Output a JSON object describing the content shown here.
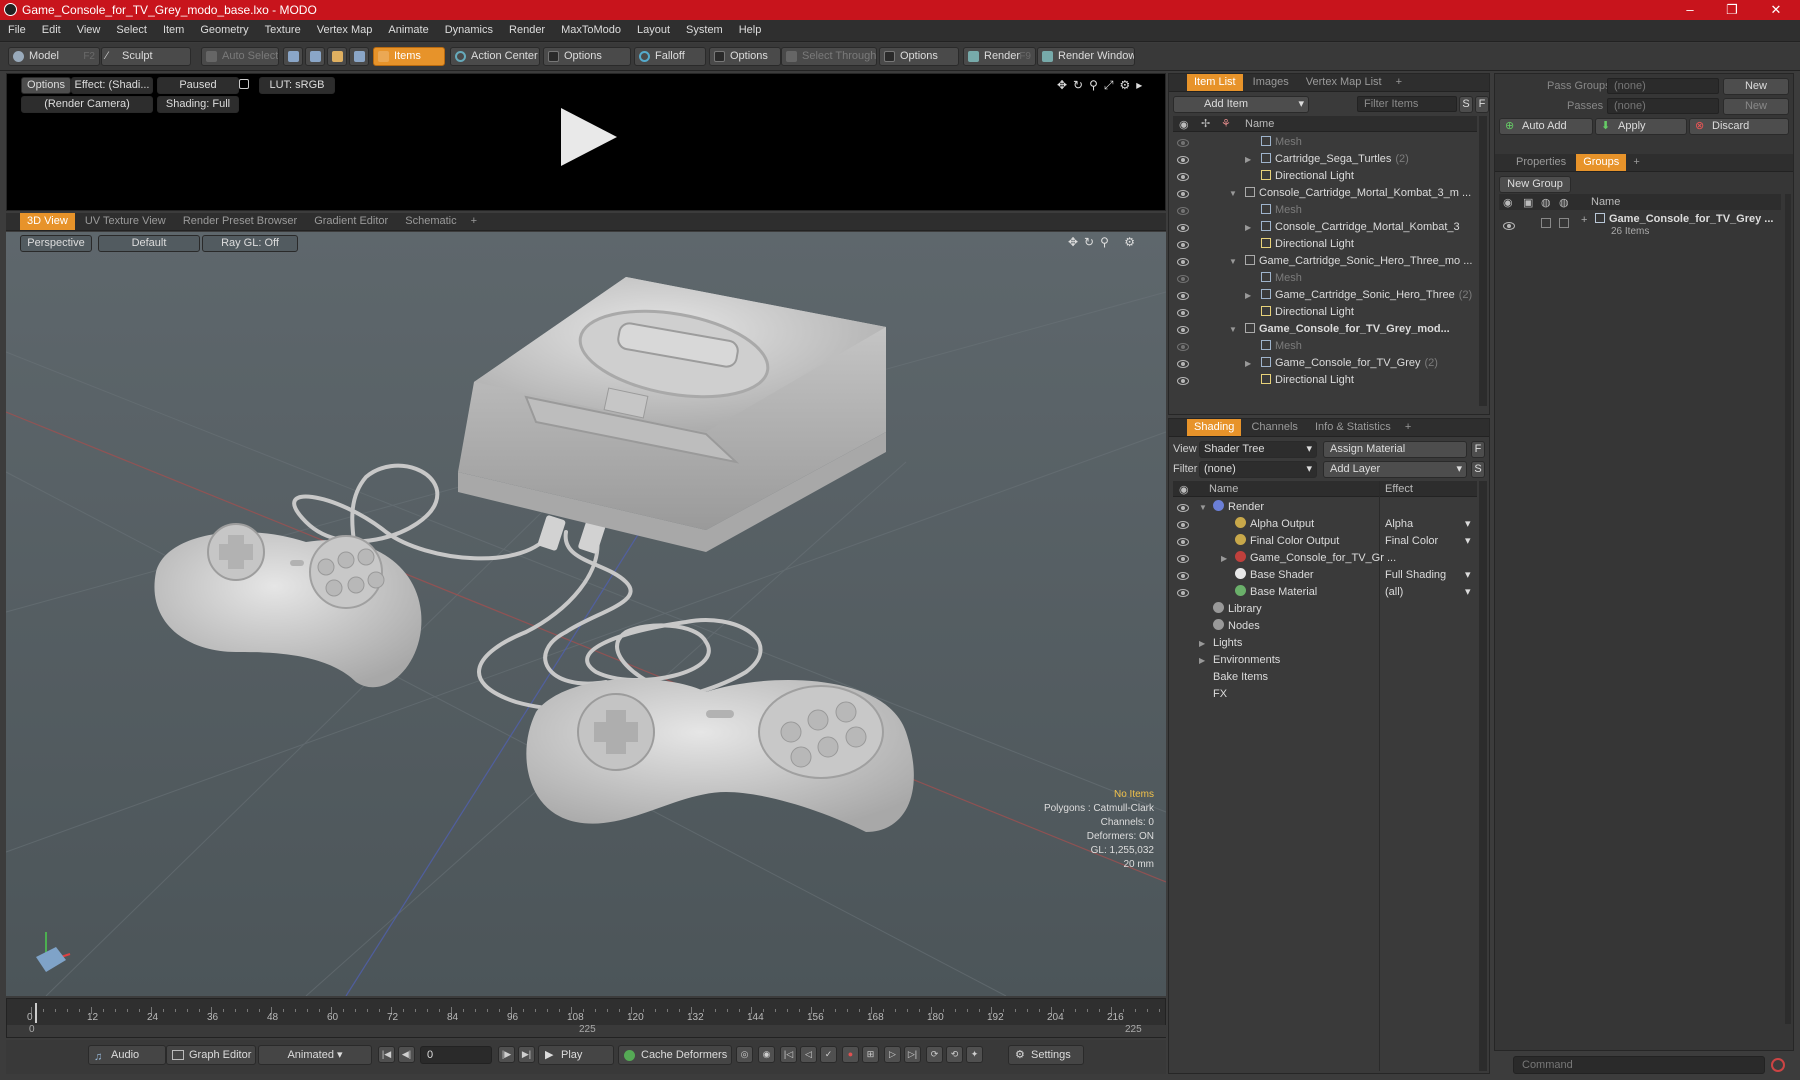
{
  "window": {
    "title": "Game_Console_for_TV_Grey_modo_base.lxo - MODO",
    "minimize": "–",
    "maximize": "❐",
    "close": "✕"
  },
  "menu": [
    "File",
    "Edit",
    "View",
    "Select",
    "Item",
    "Geometry",
    "Texture",
    "Vertex Map",
    "Animate",
    "Dynamics",
    "Render",
    "MaxToModo",
    "Layout",
    "System",
    "Help"
  ],
  "toolbar": {
    "model": "Model",
    "model_key": "F2",
    "sculpt": "Sculpt",
    "auto_select": "Auto Select",
    "items": "Items",
    "action_center": "Action Center",
    "options1": "Options",
    "falloff": "Falloff",
    "options2": "Options",
    "select_through": "Select Through",
    "options3": "Options",
    "render": "Render",
    "render_key": "F9",
    "render_window": "Render Window"
  },
  "preview": {
    "options": "Options",
    "effect": "Effect: (Shadi...",
    "paused": "Paused",
    "lut": "LUT: sRGB",
    "camera": "(Render Camera)",
    "shading": "Shading: Full"
  },
  "viewport_tabs": [
    "3D View",
    "UV Texture View",
    "Render Preset Browser",
    "Gradient Editor",
    "Schematic"
  ],
  "viewport": {
    "perspective": "Perspective",
    "default": "Default",
    "raygl": "Ray GL: Off",
    "hud": {
      "no_items": "No Items",
      "polygons": "Polygons : Catmull-Clark",
      "channels": "Channels: 0",
      "deformers": "Deformers: ON",
      "gl": "GL: 1,255,032",
      "scale": "20 mm"
    }
  },
  "timeline": {
    "ticks": [
      "0",
      "12",
      "24",
      "36",
      "48",
      "60",
      "72",
      "84",
      "96",
      "108",
      "120",
      "132",
      "144",
      "156",
      "168",
      "180",
      "192",
      "204",
      "216"
    ],
    "start": "0",
    "mid": "225",
    "end": "225"
  },
  "bottom": {
    "audio": "Audio",
    "graph_editor": "Graph Editor",
    "animated": "Animated",
    "frame": "0",
    "play": "Play",
    "cache_deformers": "Cache Deformers",
    "settings": "Settings"
  },
  "item_list": {
    "tabs": [
      "Item List",
      "Images",
      "Vertex Map List"
    ],
    "add_item": "Add Item",
    "filter_items": "Filter Items",
    "filter_s": "S",
    "filter_f": "F",
    "col_name": "Name",
    "rows": [
      {
        "label": "Mesh",
        "count": "",
        "dim": true
      },
      {
        "label": "Cartridge_Sega_Turtles",
        "count": "(2)",
        "dim": false
      },
      {
        "label": "Directional Light",
        "count": "",
        "dim": false
      },
      {
        "label": "Console_Cartridge_Mortal_Kombat_3_m ...",
        "count": "",
        "dim": false
      },
      {
        "label": "Mesh",
        "count": "",
        "dim": true
      },
      {
        "label": "Console_Cartridge_Mortal_Kombat_3",
        "count": "",
        "dim": false
      },
      {
        "label": "Directional Light",
        "count": "",
        "dim": false
      },
      {
        "label": "Game_Cartridge_Sonic_Hero_Three_mo ...",
        "count": "",
        "dim": false
      },
      {
        "label": "Mesh",
        "count": "",
        "dim": true
      },
      {
        "label": "Game_Cartridge_Sonic_Hero_Three",
        "count": "(2)",
        "dim": false
      },
      {
        "label": "Directional Light",
        "count": "",
        "dim": false
      },
      {
        "label": "Game_Console_for_TV_Grey_mod...",
        "count": "",
        "dim": false
      },
      {
        "label": "Mesh",
        "count": "",
        "dim": true
      },
      {
        "label": "Game_Console_for_TV_Grey",
        "count": "(2)",
        "dim": false
      },
      {
        "label": "Directional Light",
        "count": "",
        "dim": false
      }
    ]
  },
  "shading": {
    "tabs": [
      "Shading",
      "Channels",
      "Info & Statistics"
    ],
    "view_label": "View",
    "view_value": "Shader Tree",
    "assign_material": "Assign Material",
    "af": "F",
    "filter_label": "Filter",
    "filter_value": "(none)",
    "add_layer": "Add Layer",
    "as": "S",
    "col_name": "Name",
    "col_effect": "Effect",
    "rows": [
      {
        "label": "Render",
        "effect": ""
      },
      {
        "label": "Alpha Output",
        "effect": "Alpha"
      },
      {
        "label": "Final Color Output",
        "effect": "Final Color"
      },
      {
        "label": "Game_Console_for_TV_Gr ...",
        "effect": ""
      },
      {
        "label": "Base Shader",
        "effect": "Full Shading"
      },
      {
        "label": "Base Material",
        "effect": "(all)"
      },
      {
        "label": "Library",
        "effect": ""
      },
      {
        "label": "Nodes",
        "effect": ""
      },
      {
        "label": "Lights",
        "effect": ""
      },
      {
        "label": "Environments",
        "effect": ""
      },
      {
        "label": "Bake Items",
        "effect": ""
      },
      {
        "label": "FX",
        "effect": ""
      }
    ]
  },
  "right": {
    "pass_groups": "Pass Groups",
    "pass_groups_val": "(none)",
    "new": "New",
    "passes": "Passes",
    "passes_val": "(none)",
    "new2": "New",
    "auto_add": "Auto Add",
    "apply": "Apply",
    "discard": "Discard",
    "tabs": [
      "Properties",
      "Groups"
    ],
    "new_group": "New Group",
    "col_name": "Name",
    "group_name": "Game_Console_for_TV_Grey ...",
    "group_count": "26 Items",
    "command": "Command"
  }
}
